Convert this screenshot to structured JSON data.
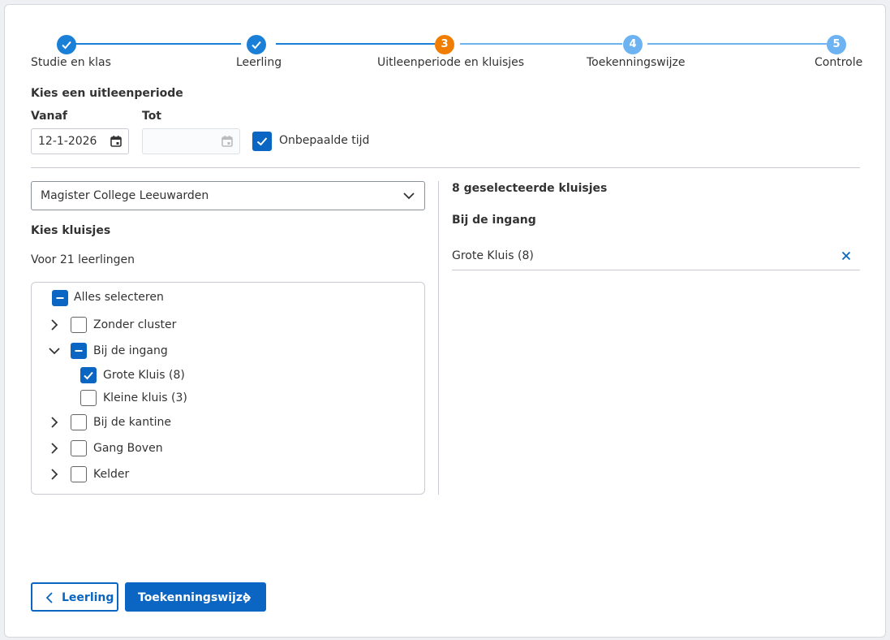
{
  "stepper": {
    "steps": [
      {
        "number": "",
        "label": "Studie en klas",
        "state": "done"
      },
      {
        "number": "",
        "label": "Leerling",
        "state": "done"
      },
      {
        "number": "3",
        "label": "Uitleenperiode en kluisjes",
        "state": "current"
      },
      {
        "number": "4",
        "label": "Toekenningswijze",
        "state": "todo"
      },
      {
        "number": "5",
        "label": "Controle",
        "state": "todo"
      }
    ]
  },
  "period": {
    "heading": "Kies een uitleenperiode",
    "from_label": "Vanaf",
    "from_value": "12-1-2026",
    "to_label": "Tot",
    "to_value": "",
    "indefinite_label": "Onbepaalde tijd",
    "indefinite_checked": true
  },
  "lockers": {
    "school_select": "Magister College Leeuwarden",
    "heading": "Kies kluisjes",
    "for_students": "Voor 21 leerlingen",
    "select_all": "Alles selecteren",
    "tree": [
      {
        "label": "Zonder cluster",
        "state": "unchecked",
        "expanded": false
      },
      {
        "label": "Bij de ingang",
        "state": "partial",
        "expanded": true,
        "children": [
          {
            "label": "Grote Kluis (8)",
            "state": "checked"
          },
          {
            "label": "Kleine kluis (3)",
            "state": "unchecked"
          }
        ]
      },
      {
        "label": "Bij de kantine",
        "state": "unchecked",
        "expanded": false
      },
      {
        "label": "Gang Boven",
        "state": "unchecked",
        "expanded": false
      },
      {
        "label": "Kelder",
        "state": "unchecked",
        "expanded": false
      }
    ]
  },
  "selection": {
    "title": "8 geselecteerde kluisjes",
    "group": "Bij de ingang",
    "items": [
      "Grote Kluis (8)"
    ]
  },
  "footer": {
    "back_label": "Leerling",
    "next_label": "Toekenningswijze"
  },
  "colors": {
    "primary": "#0a66c2",
    "done": "#1a7fd6",
    "current": "#f07d00",
    "todo": "#6db3f2"
  }
}
